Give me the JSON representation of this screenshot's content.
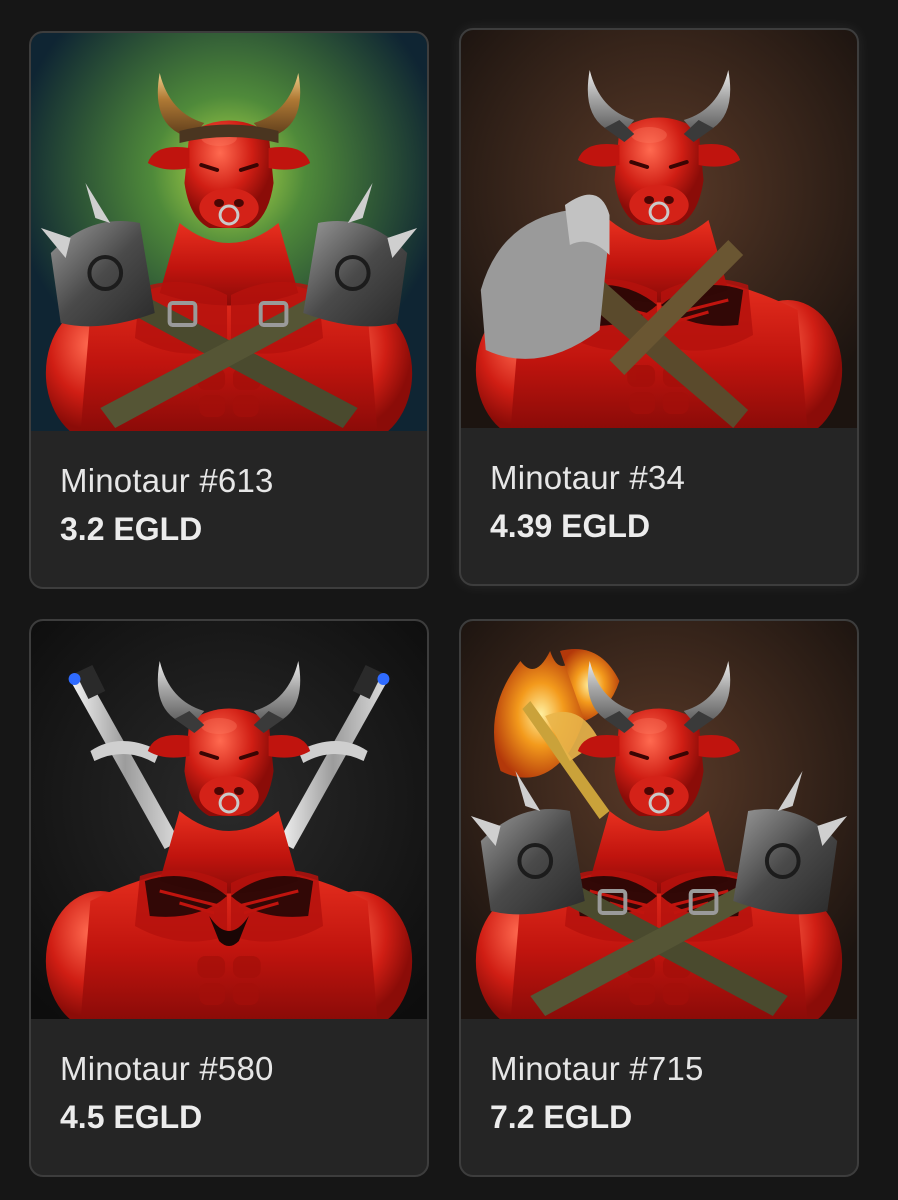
{
  "items": [
    {
      "name": "Minotaur #613",
      "price": "3.2 EGLD",
      "background": "teal-green-glow",
      "horns": "bronze",
      "gear": "spiked-pauldrons-crossed-straps"
    },
    {
      "name": "Minotaur #34",
      "price": "4.39 EGLD",
      "background": "brown-hex",
      "horns": "silver",
      "gear": "stone-shoulder-tattoo-bandolier"
    },
    {
      "name": "Minotaur #580",
      "price": "4.5 EGLD",
      "background": "dark-grid",
      "horns": "silver",
      "gear": "crossed-swords-tattoo"
    },
    {
      "name": "Minotaur #715",
      "price": "7.2 EGLD",
      "background": "brown-hex",
      "horns": "silver",
      "gear": "flaming-axe-spiked-pauldrons"
    }
  ],
  "colors": {
    "page_bg": "#161616",
    "card_bg": "#252525",
    "card_border": "#3d3d3d",
    "minotaur_red": "#c5140f",
    "text": "#e6e6e6"
  }
}
